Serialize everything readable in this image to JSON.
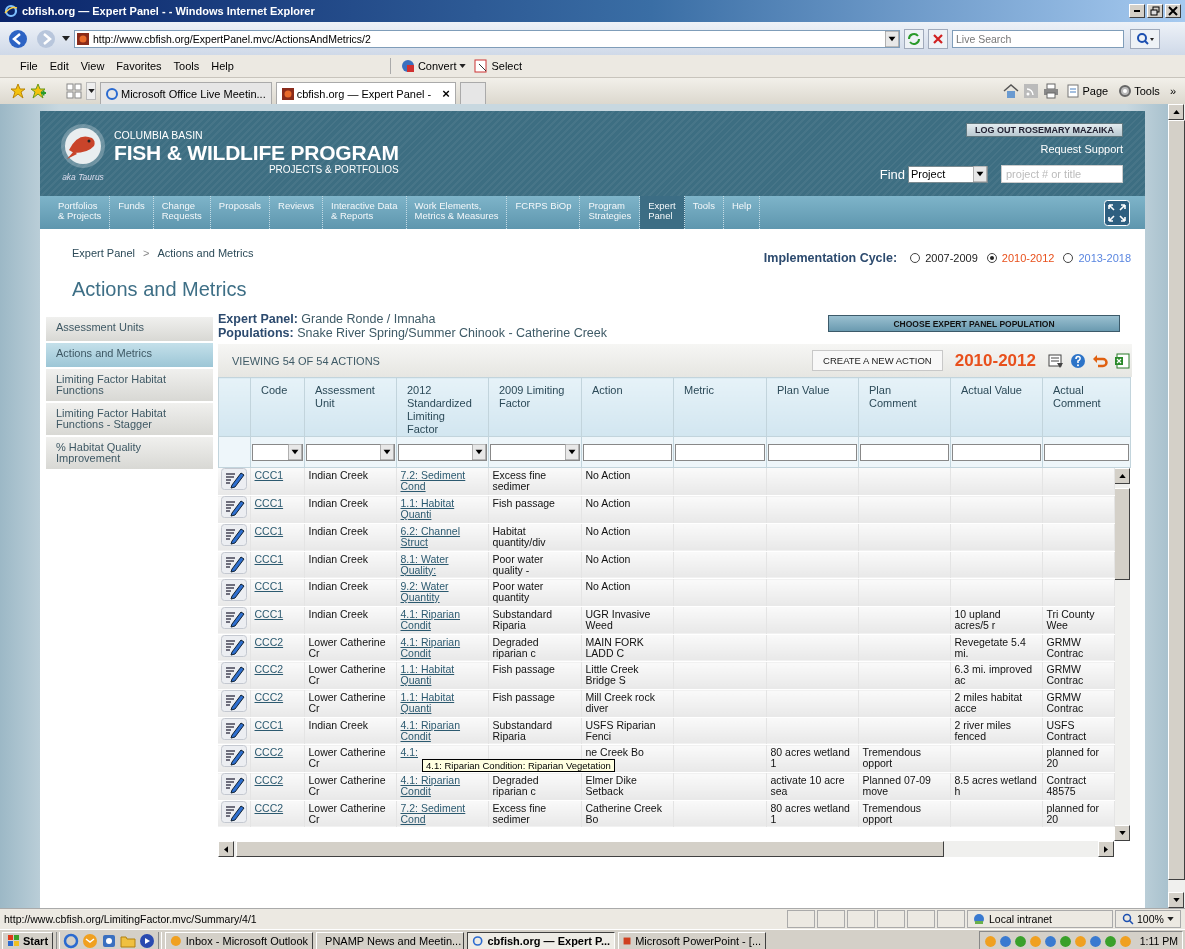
{
  "window": {
    "title": "cbfish.org — Expert Panel - - Windows Internet Explorer"
  },
  "address_bar": {
    "url": "http://www.cbfish.org/ExpertPanel.mvc/ActionsAndMetrics/2"
  },
  "search_box": {
    "placeholder": "Live Search"
  },
  "menu": [
    "File",
    "Edit",
    "View",
    "Favorites",
    "Tools",
    "Help"
  ],
  "toolbar": [
    "Convert",
    "Select"
  ],
  "browser_tabs": [
    {
      "label": "Microsoft Office Live Meetin...",
      "selected": false
    },
    {
      "label": "cbfish.org — Expert Panel -",
      "selected": true
    }
  ],
  "tab_close": "×",
  "command_bar": [
    "Page",
    "Tools",
    "»"
  ],
  "site_header": {
    "subtitle": "COLUMBIA BASIN",
    "title": "FISH & WILDLIFE PROGRAM",
    "tagline": "PROJECTS & PORTFOLIOS",
    "logo_caption": "aka Taurus",
    "logout": "LOG OUT ROSEMARY MAZAIKA",
    "support": "Request Support",
    "find_label": "Find",
    "find_select": "Project",
    "find_placeholder": "project # or title"
  },
  "nav": [
    {
      "label": "Portfolios\n& Projects",
      "selected": false
    },
    {
      "label": "Funds",
      "selected": false
    },
    {
      "label": "Change\nRequests",
      "selected": false
    },
    {
      "label": "Proposals",
      "selected": false
    },
    {
      "label": "Reviews",
      "selected": false
    },
    {
      "label": "Interactive Data\n& Reports",
      "selected": false
    },
    {
      "label": "Work Elements,\nMetrics & Measures",
      "selected": false
    },
    {
      "label": "FCRPS BiOp",
      "selected": false
    },
    {
      "label": "Program\nStrategies",
      "selected": false
    },
    {
      "label": "Expert\nPanel",
      "selected": true
    },
    {
      "label": "Tools",
      "selected": false
    },
    {
      "label": "Help",
      "selected": false
    }
  ],
  "breadcrumb": {
    "items": [
      "Expert Panel",
      "Actions and Metrics"
    ],
    "separator": ">"
  },
  "cycle": {
    "label": "Implementation Cycle:",
    "options": [
      {
        "label": "2007-2009",
        "selected": false,
        "color": "#222222"
      },
      {
        "label": "2010-2012",
        "selected": true,
        "color": "#e8501c"
      },
      {
        "label": "2013-2018",
        "selected": false,
        "color": "#5a86e0"
      }
    ]
  },
  "page_title": "Actions and Metrics",
  "side_nav": [
    {
      "label": "Assessment Units",
      "selected": false
    },
    {
      "label": "Actions and Metrics",
      "selected": true
    },
    {
      "label": "Limiting Factor Habitat Functions",
      "selected": false
    },
    {
      "label": "Limiting Factor Habitat Functions - Stagger",
      "selected": false
    },
    {
      "label": "% Habitat Quality Improvement",
      "selected": false
    }
  ],
  "panel_info": [
    "**Expert Panel:** Grande Ronde / Imnaha",
    "**Populations:** Snake River Spring/Summer Chinook - Catherine Creek"
  ],
  "choose_button": "CHOOSE EXPERT PANEL POPULATION",
  "grid": {
    "count": "VIEWING 54 OF 54 ACTIONS",
    "create_button": "CREATE A NEW ACTION",
    "cycle_label": "2010-2012",
    "columns": [
      {
        "label": "Code",
        "kind": "link"
      },
      {
        "label": "Assessment Unit",
        "kind": "text"
      },
      {
        "label": "2012 Standardized Limiting Factor",
        "kind": "link"
      },
      {
        "label": "2009 Limiting Factor",
        "kind": "text"
      },
      {
        "label": "Action",
        "kind": "text"
      },
      {
        "label": "Metric"
      },
      {
        "label": "Plan Value",
        "kind": "text"
      },
      {
        "label": "Plan Comment",
        "kind": "text"
      },
      {
        "label": "Actual Value",
        "kind": "text"
      },
      {
        "label": "Actual Comment",
        "kind": "text"
      }
    ],
    "rows": [
      {
        "code": "CCC1",
        "assessment_unit": "Indian Creek",
        "std_factor": "7.2: Sediment Cond",
        "factor_2009": "Excess fine sedimer",
        "action": "No Action"
      },
      {
        "code": "CCC1",
        "assessment_unit": "Indian Creek",
        "std_factor": "1.1: Habitat Quanti",
        "factor_2009": "Fish passage",
        "action": "No Action"
      },
      {
        "code": "CCC1",
        "assessment_unit": "Indian Creek",
        "std_factor": "6.2: Channel Struct",
        "factor_2009": "Habitat quantity/div",
        "action": "No Action"
      },
      {
        "code": "CCC1",
        "assessment_unit": "Indian Creek",
        "std_factor": "8.1: Water Quality:",
        "factor_2009": "Poor water quality -",
        "action": "No Action"
      },
      {
        "code": "CCC1",
        "assessment_unit": "Indian Creek",
        "std_factor": "9.2: Water Quantity",
        "factor_2009": "Poor water quantity",
        "action": "No Action"
      },
      {
        "code": "CCC1",
        "assessment_unit": "Indian Creek",
        "std_factor": "4.1: Riparian Condit",
        "factor_2009": "Substandard Riparia",
        "action": "UGR Invasive Weed",
        "actual_value": "10 upland acres/5 r",
        "actual_comment": "Tri County Wee"
      },
      {
        "code": "CCC2",
        "assessment_unit": "Lower Catherine Cr",
        "std_factor": "4.1: Riparian Condit",
        "factor_2009": "Degraded riparian c",
        "action": "MAIN FORK LADD C",
        "actual_value": "Revegetate 5.4 mi.",
        "actual_comment": "GRMW Contrac"
      },
      {
        "code": "CCC2",
        "assessment_unit": "Lower Catherine Cr",
        "std_factor": "1.1: Habitat Quanti",
        "factor_2009": "Fish passage",
        "action": "Little Creek Bridge S",
        "actual_value": "6.3 mi. improved ac",
        "actual_comment": "GRMW Contrac"
      },
      {
        "code": "CCC2",
        "assessment_unit": "Lower Catherine Cr",
        "std_factor": "1.1: Habitat Quanti",
        "factor_2009": "Fish passage",
        "action": "Mill Creek rock diver",
        "actual_value": "2 miles habitat acce",
        "actual_comment": "GRMW Contrac"
      },
      {
        "code": "CCC1",
        "assessment_unit": "Indian Creek",
        "std_factor": "4.1: Riparian Condit",
        "factor_2009": "Substandard Riparia",
        "action": "USFS Riparian Fenci",
        "actual_value": "2 river miles fenced",
        "actual_comment": "USFS Contract"
      },
      {
        "code": "CCC2",
        "assessment_unit": "Lower Catherine Cr",
        "std_factor": "4.1:",
        "action": "ne Creek Bo",
        "plan_value": "80 acres wetland 1",
        "plan_comment": "Tremendous opport",
        "actual_comment": "planned for 20"
      },
      {
        "code": "CCC2",
        "assessment_unit": "Lower Catherine Cr",
        "std_factor": "4.1: Riparian Condit",
        "factor_2009": "Degraded riparian c",
        "action": "Elmer Dike Setback",
        "plan_value": "activate 10 acre sea",
        "plan_comment": "Planned 07-09 move",
        "actual_value": "8.5 acres wetland h",
        "actual_comment": "Contract 48575"
      },
      {
        "code": "CCC2",
        "assessment_unit": "Lower Catherine Cr",
        "std_factor": "7.2: Sediment Cond",
        "factor_2009": "Excess fine sedimer",
        "action": "Catherine Creek Bo",
        "plan_value": "80 acres wetland 1",
        "plan_comment": "Tremendous opport",
        "actual_comment": "planned for 20"
      }
    ]
  },
  "tooltip": "4.1: Riparian Condition: Riparian Vegetation",
  "status_bar": {
    "url": "http://www.cbfish.org/LimitingFactor.mvc/Summary/4/1",
    "zone": "Local intranet",
    "zoom": "100%"
  },
  "taskbar": {
    "start": "Start",
    "tasks": [
      {
        "label": "Inbox - Microsoft Outlook",
        "selected": false
      },
      {
        "label": "PNAMP News and Meetin...",
        "selected": false
      },
      {
        "label": "cbfish.org — Expert P...",
        "selected": true
      },
      {
        "label": "Microsoft PowerPoint - [...",
        "selected": false
      }
    ],
    "time": "1:11 PM"
  }
}
